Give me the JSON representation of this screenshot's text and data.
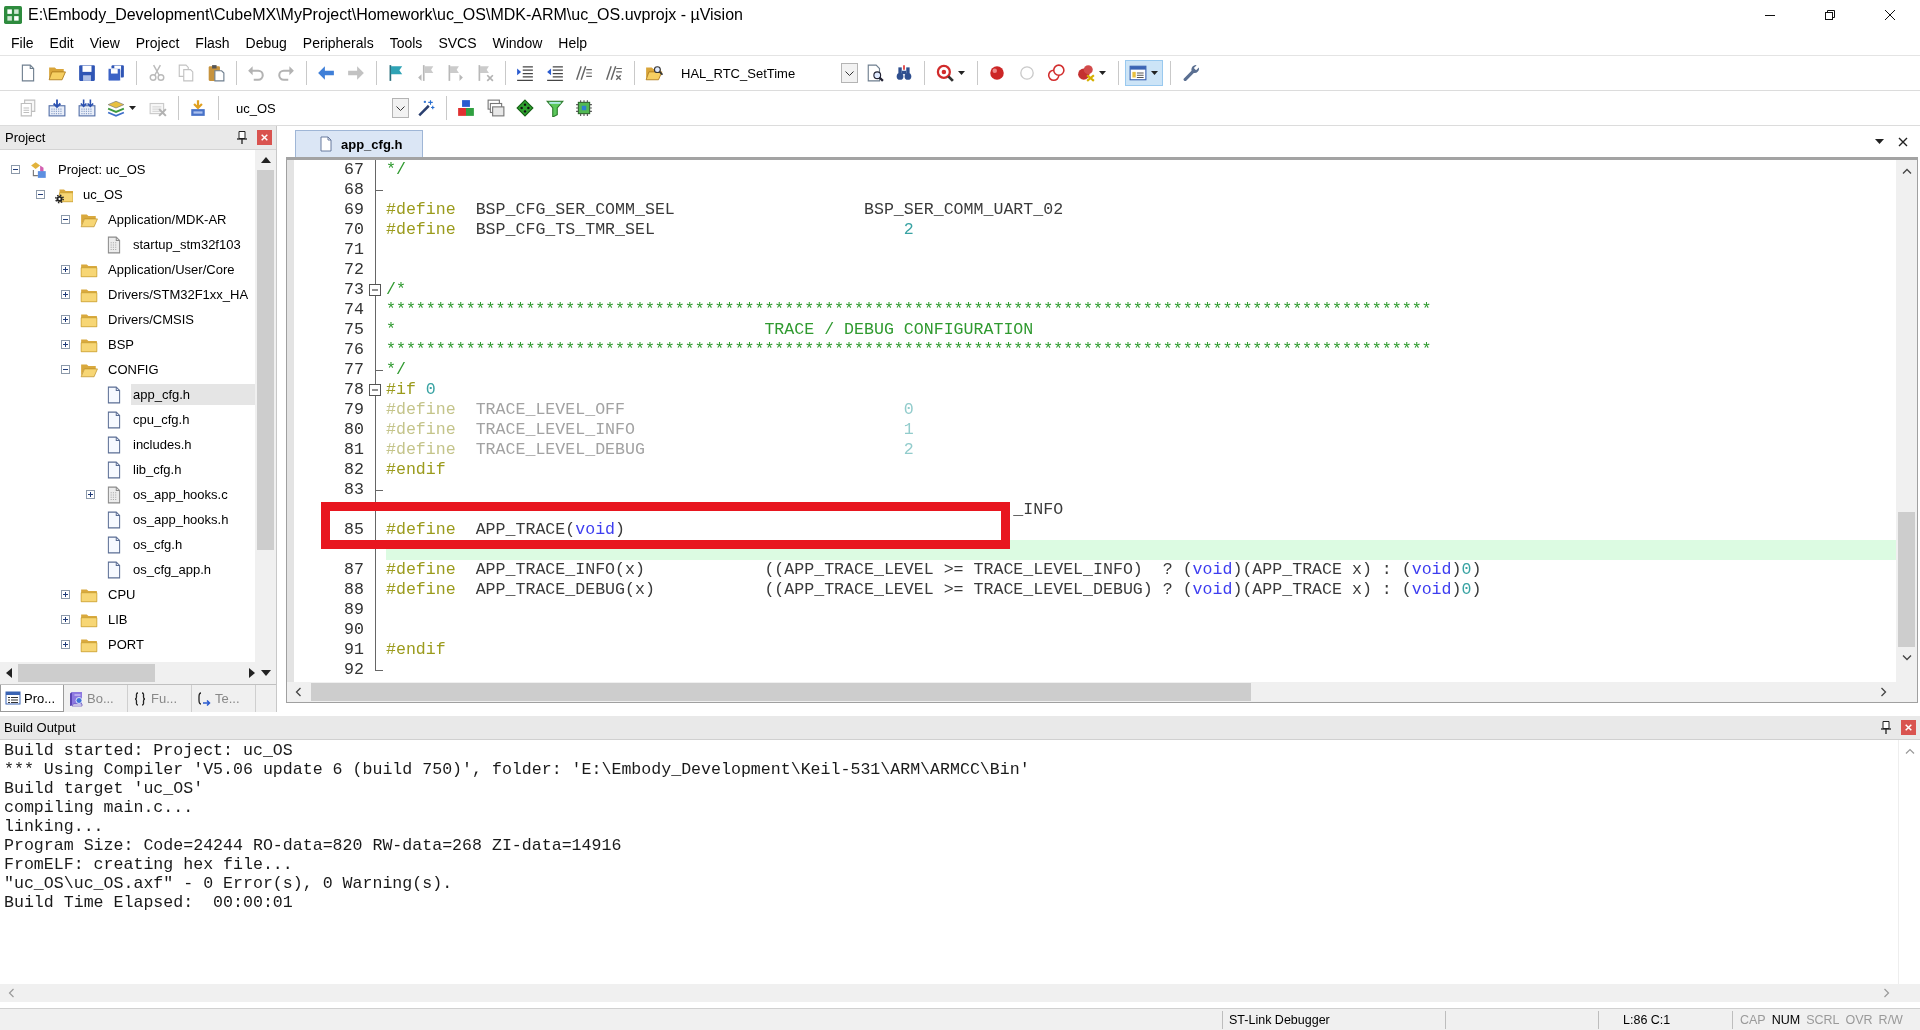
{
  "window": {
    "title": "E:\\Embody_Development\\CubeMX\\MyProject\\Homework\\uc_OS\\MDK-ARM\\uc_OS.uvprojx - µVision"
  },
  "menu": [
    "File",
    "Edit",
    "View",
    "Project",
    "Flash",
    "Debug",
    "Peripherals",
    "Tools",
    "SVCS",
    "Window",
    "Help"
  ],
  "toolbars": [
    [
      {
        "kind": "new",
        "disabled": false,
        "on": false
      },
      {
        "kind": "open",
        "disabled": false,
        "on": false
      },
      {
        "kind": "save",
        "disabled": false,
        "on": false
      },
      {
        "kind": "saveall",
        "disabled": false,
        "on": false
      },
      {
        "kind": "sep"
      },
      {
        "kind": "cut",
        "disabled": true,
        "on": false
      },
      {
        "kind": "copy",
        "disabled": true,
        "on": false
      },
      {
        "kind": "paste",
        "disabled": false,
        "on": false
      },
      {
        "kind": "sep"
      },
      {
        "kind": "undo",
        "disabled": true,
        "on": false
      },
      {
        "kind": "redo",
        "disabled": true,
        "on": false
      },
      {
        "kind": "sep"
      },
      {
        "kind": "back",
        "disabled": false,
        "on": false
      },
      {
        "kind": "forward",
        "disabled": true,
        "on": false
      },
      {
        "kind": "sep"
      },
      {
        "kind": "bookmark",
        "disabled": false,
        "on": false
      },
      {
        "kind": "bookmarkprev",
        "disabled": true,
        "on": false
      },
      {
        "kind": "bookmarknext",
        "disabled": true,
        "on": false
      },
      {
        "kind": "bookmarkclear",
        "disabled": true,
        "on": false
      },
      {
        "kind": "sep"
      },
      {
        "kind": "indent",
        "disabled": false,
        "on": false
      },
      {
        "kind": "unindent",
        "disabled": false,
        "on": false
      },
      {
        "kind": "comment",
        "disabled": false,
        "on": false
      },
      {
        "kind": "uncomment",
        "disabled": false,
        "on": false
      },
      {
        "kind": "sep"
      },
      {
        "kind": "findfiles",
        "disabled": false,
        "on": false
      },
      {
        "kind": "combo",
        "value": "HAL_RTC_SetTime"
      },
      {
        "kind": "find",
        "disabled": false,
        "on": false
      },
      {
        "kind": "incfind",
        "disabled": false,
        "on": false
      },
      {
        "kind": "sep"
      },
      {
        "kind": "debug",
        "disabled": false,
        "on": false
      },
      {
        "kind": "sep"
      },
      {
        "kind": "breakpoint",
        "disabled": false,
        "on": false
      },
      {
        "kind": "bptoggle",
        "disabled": true,
        "on": false
      },
      {
        "kind": "bpdisable",
        "disabled": false,
        "on": false
      },
      {
        "kind": "bpkill",
        "disabled": false,
        "on": false
      },
      {
        "kind": "sep"
      },
      {
        "kind": "windows",
        "disabled": false,
        "on": true
      },
      {
        "kind": "sep"
      },
      {
        "kind": "config",
        "disabled": false,
        "on": false
      }
    ],
    [
      {
        "kind": "translate",
        "disabled": true,
        "on": false
      },
      {
        "kind": "build",
        "disabled": false,
        "on": false
      },
      {
        "kind": "rebuild",
        "disabled": false,
        "on": false
      },
      {
        "kind": "batch",
        "disabled": false,
        "on": false
      },
      {
        "kind": "stopbuild",
        "disabled": true,
        "on": false
      },
      {
        "kind": "sep"
      },
      {
        "kind": "load",
        "disabled": false,
        "on": false
      },
      {
        "kind": "sep"
      },
      {
        "kind": "combo",
        "value": "uc_OS"
      },
      {
        "kind": "options",
        "disabled": false,
        "on": false
      },
      {
        "kind": "sep"
      },
      {
        "kind": "manage",
        "disabled": false,
        "on": false
      },
      {
        "kind": "packs",
        "disabled": false,
        "on": false
      },
      {
        "kind": "diamond",
        "disabled": false,
        "on": false
      },
      {
        "kind": "funnel",
        "disabled": false,
        "on": false
      },
      {
        "kind": "chip",
        "disabled": false,
        "on": false
      }
    ]
  ],
  "project_panel": {
    "title": "Project",
    "tree": [
      {
        "label": "Project: uc_OS",
        "kind": "project",
        "expanded": true,
        "selected": false,
        "children": [
          {
            "label": "uc_OS",
            "kind": "target",
            "expanded": true,
            "selected": false,
            "children": [
              {
                "label": "Application/MDK-AR",
                "kind": "group",
                "expanded": true,
                "selected": false,
                "children": [
                  {
                    "label": "startup_stm32f103",
                    "kind": "source",
                    "selected": false
                  }
                ]
              },
              {
                "label": "Application/User/Core",
                "kind": "group",
                "expanded": false,
                "selected": false
              },
              {
                "label": "Drivers/STM32F1xx_HA",
                "kind": "group",
                "expanded": false,
                "selected": false
              },
              {
                "label": "Drivers/CMSIS",
                "kind": "group",
                "expanded": false,
                "selected": false
              },
              {
                "label": "BSP",
                "kind": "group",
                "expanded": false,
                "selected": false
              },
              {
                "label": "CONFIG",
                "kind": "group",
                "expanded": true,
                "selected": false,
                "children": [
                  {
                    "label": "app_cfg.h",
                    "kind": "file",
                    "selected": true
                  },
                  {
                    "label": "cpu_cfg.h",
                    "kind": "file",
                    "selected": false
                  },
                  {
                    "label": "includes.h",
                    "kind": "file",
                    "selected": false
                  },
                  {
                    "label": "lib_cfg.h",
                    "kind": "file",
                    "selected": false
                  },
                  {
                    "label": "os_app_hooks.c",
                    "kind": "source",
                    "expanded": false,
                    "selected": false
                  },
                  {
                    "label": "os_app_hooks.h",
                    "kind": "file",
                    "selected": false
                  },
                  {
                    "label": "os_cfg.h",
                    "kind": "file",
                    "selected": false
                  },
                  {
                    "label": "os_cfg_app.h",
                    "kind": "file",
                    "selected": false
                  }
                ]
              },
              {
                "label": "CPU",
                "kind": "group",
                "expanded": false,
                "selected": false
              },
              {
                "label": "LIB",
                "kind": "group",
                "expanded": false,
                "selected": false
              },
              {
                "label": "PORT",
                "kind": "group",
                "expanded": false,
                "selected": false
              }
            ]
          }
        ]
      }
    ],
    "tabs": [
      {
        "label": "Pro...",
        "kind": "project",
        "selected": true
      },
      {
        "label": "Bo...",
        "kind": "books",
        "selected": false
      },
      {
        "label": "Fu...",
        "kind": "functions",
        "selected": false
      },
      {
        "label": "Te...",
        "kind": "templates",
        "selected": false
      }
    ]
  },
  "editor": {
    "tabs": [
      {
        "label": "app_cfg.h",
        "selected": true
      }
    ],
    "lines": [
      {
        "number": "67",
        "kind": "line",
        "current": false,
        "boxed": false,
        "tokens": [
          {
            "kind": "comment",
            "text": "*/"
          }
        ]
      },
      {
        "number": "68",
        "kind": "foldend",
        "current": false,
        "boxed": false
      },
      {
        "number": "69",
        "kind": "line",
        "current": false,
        "boxed": false,
        "tokens": [
          {
            "kind": "pre",
            "text": "#define"
          },
          {
            "kind": "plain",
            "text": "  BSP_CFG_SER_COMM_SEL                   BSP_SER_COMM_UART_02"
          }
        ]
      },
      {
        "number": "70",
        "kind": "line",
        "current": false,
        "boxed": false,
        "tokens": [
          {
            "kind": "pre",
            "text": "#define"
          },
          {
            "kind": "plain",
            "text": "  BSP_CFG_TS_TMR_SEL                         "
          },
          {
            "kind": "num",
            "text": "2"
          }
        ]
      },
      {
        "number": "71",
        "kind": "line",
        "current": false,
        "boxed": false
      },
      {
        "number": "72",
        "kind": "line",
        "current": false,
        "boxed": false
      },
      {
        "number": "73",
        "kind": "foldstart",
        "current": false,
        "boxed": false,
        "tokens": [
          {
            "kind": "comment",
            "text": "/*"
          }
        ]
      },
      {
        "number": "74",
        "kind": "line",
        "current": false,
        "boxed": false,
        "tokens": [
          {
            "kind": "comment",
            "text": "*********************************************************************************************************"
          }
        ]
      },
      {
        "number": "75",
        "kind": "line",
        "current": false,
        "boxed": false,
        "tokens": [
          {
            "kind": "comment",
            "text": "*                                     TRACE / DEBUG CONFIGURATION"
          }
        ]
      },
      {
        "number": "76",
        "kind": "line",
        "current": false,
        "boxed": false,
        "tokens": [
          {
            "kind": "comment",
            "text": "*********************************************************************************************************"
          }
        ]
      },
      {
        "number": "77",
        "kind": "foldend",
        "current": false,
        "boxed": false,
        "tokens": [
          {
            "kind": "comment",
            "text": "*/"
          }
        ]
      },
      {
        "number": "78",
        "kind": "foldstart",
        "current": false,
        "boxed": false,
        "tokens": [
          {
            "kind": "pre",
            "text": "#if "
          },
          {
            "kind": "num",
            "text": "0"
          }
        ]
      },
      {
        "number": "79",
        "kind": "line",
        "current": false,
        "boxed": false,
        "tokens": [
          {
            "kind": "dimpre",
            "text": "#define"
          },
          {
            "kind": "dimplain",
            "text": "  TRACE_LEVEL_OFF                            "
          },
          {
            "kind": "dimnum",
            "text": "0"
          }
        ]
      },
      {
        "number": "80",
        "kind": "line",
        "current": false,
        "boxed": false,
        "tokens": [
          {
            "kind": "dimpre",
            "text": "#define"
          },
          {
            "kind": "dimplain",
            "text": "  TRACE_LEVEL_INFO                           "
          },
          {
            "kind": "dimnum",
            "text": "1"
          }
        ]
      },
      {
        "number": "81",
        "kind": "line",
        "current": false,
        "boxed": false,
        "tokens": [
          {
            "kind": "dimpre",
            "text": "#define"
          },
          {
            "kind": "dimplain",
            "text": "  TRACE_LEVEL_DEBUG                          "
          },
          {
            "kind": "dimnum",
            "text": "2"
          }
        ]
      },
      {
        "number": "82",
        "kind": "line",
        "current": false,
        "boxed": false,
        "tokens": [
          {
            "kind": "pre",
            "text": "#endif"
          }
        ]
      },
      {
        "number": "83",
        "kind": "foldend",
        "current": false,
        "boxed": false
      },
      {
        "kind": "line",
        "current": false,
        "boxed": false,
        "tokens": [
          {
            "kind": "plain",
            "text": "                                                               _INFO"
          }
        ]
      },
      {
        "number": "85",
        "kind": "line",
        "current": false,
        "boxed": true,
        "tokens": [
          {
            "kind": "pre",
            "text": "#define"
          },
          {
            "kind": "plain",
            "text": "  APP_TRACE("
          },
          {
            "kind": "kw",
            "text": "void"
          },
          {
            "kind": "plain",
            "text": ")"
          }
        ]
      },
      {
        "kind": "line",
        "current": true,
        "boxed": false
      },
      {
        "number": "87",
        "kind": "line",
        "current": false,
        "boxed": false,
        "tokens": [
          {
            "kind": "pre",
            "text": "#define"
          },
          {
            "kind": "plain",
            "text": "  APP_TRACE_INFO(x)            ((APP_TRACE_LEVEL >= TRACE_LEVEL_INFO)  ? ("
          },
          {
            "kind": "kw",
            "text": "void"
          },
          {
            "kind": "plain",
            "text": ")(APP_TRACE x) : ("
          },
          {
            "kind": "kw",
            "text": "void"
          },
          {
            "kind": "plain",
            "text": ")"
          },
          {
            "kind": "num",
            "text": "0"
          },
          {
            "kind": "plain",
            "text": ")"
          }
        ]
      },
      {
        "number": "88",
        "kind": "line",
        "current": false,
        "boxed": false,
        "tokens": [
          {
            "kind": "pre",
            "text": "#define"
          },
          {
            "kind": "plain",
            "text": "  APP_TRACE_DEBUG(x)           ((APP_TRACE_LEVEL >= TRACE_LEVEL_DEBUG) ? ("
          },
          {
            "kind": "kw",
            "text": "void"
          },
          {
            "kind": "plain",
            "text": ")(APP_TRACE x) : ("
          },
          {
            "kind": "kw",
            "text": "void"
          },
          {
            "kind": "plain",
            "text": ")"
          },
          {
            "kind": "num",
            "text": "0"
          },
          {
            "kind": "plain",
            "text": ")"
          }
        ]
      },
      {
        "number": "89",
        "kind": "line",
        "current": false,
        "boxed": false
      },
      {
        "number": "90",
        "kind": "line",
        "current": false,
        "boxed": false
      },
      {
        "number": "91",
        "kind": "line",
        "current": false,
        "boxed": false,
        "tokens": [
          {
            "kind": "pre",
            "text": "#endif"
          }
        ]
      },
      {
        "number": "92",
        "kind": "foldlast",
        "current": false,
        "boxed": false
      }
    ]
  },
  "build_output": {
    "title": "Build Output",
    "lines": [
      "Build started: Project: uc_OS",
      "*** Using Compiler 'V5.06 update 6 (build 750)', folder: 'E:\\Embody_Development\\Keil-531\\ARM\\ARMCC\\Bin'",
      "Build target 'uc_OS'",
      "compiling main.c...",
      "linking...",
      "Program Size: Code=24244 RO-data=820 RW-data=268 ZI-data=14916",
      "FromELF: creating hex file...",
      "\"uc_OS\\uc_OS.axf\" - 0 Error(s), 0 Warning(s).",
      "Build Time Elapsed:  00:00:01"
    ]
  },
  "status_bar": {
    "debugger": "ST-Link Debugger",
    "cursor": "L:86 C:1",
    "indicators": [
      {
        "label": "CAP",
        "on": false
      },
      {
        "label": "NUM",
        "on": true
      },
      {
        "label": "SCRL",
        "on": false
      },
      {
        "label": "OVR",
        "on": false
      },
      {
        "label": "R/W",
        "on": false
      }
    ]
  }
}
